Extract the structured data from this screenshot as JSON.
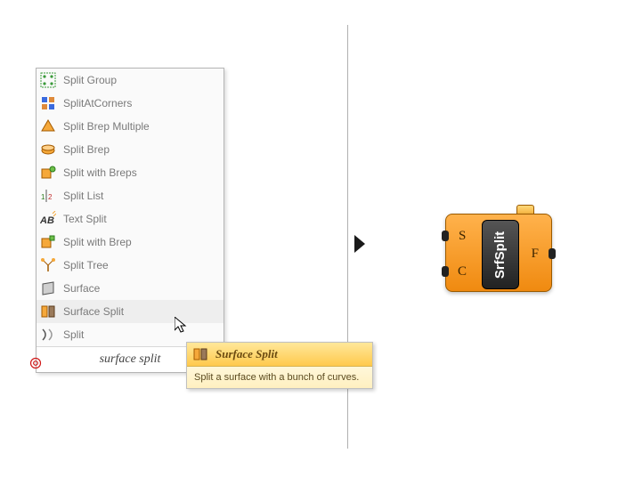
{
  "menu": {
    "items": [
      {
        "label": "Split Group",
        "icon": "split-group-icon"
      },
      {
        "label": "SplitAtCorners",
        "icon": "split-corners-icon"
      },
      {
        "label": "Split Brep Multiple",
        "icon": "split-brep-multiple-icon"
      },
      {
        "label": "Split Brep",
        "icon": "split-brep-icon"
      },
      {
        "label": "Split with Breps",
        "icon": "split-with-breps-icon"
      },
      {
        "label": "Split List",
        "icon": "split-list-icon"
      },
      {
        "label": "Text Split",
        "icon": "text-split-icon"
      },
      {
        "label": "Split with Brep",
        "icon": "split-with-brep-icon"
      },
      {
        "label": "Split Tree",
        "icon": "split-tree-icon"
      },
      {
        "label": "Surface",
        "icon": "surface-icon"
      },
      {
        "label": "Surface Split",
        "icon": "surface-split-icon"
      },
      {
        "label": "Split",
        "icon": "split-icon"
      }
    ],
    "search_text": "surface split",
    "highlighted_index": 10
  },
  "tooltip": {
    "title": "Surface Split",
    "description": "Split a surface with a bunch of curves."
  },
  "component": {
    "name": "SrfSplit",
    "inputs": {
      "s": "S",
      "c": "C"
    },
    "outputs": {
      "f": "F"
    }
  }
}
